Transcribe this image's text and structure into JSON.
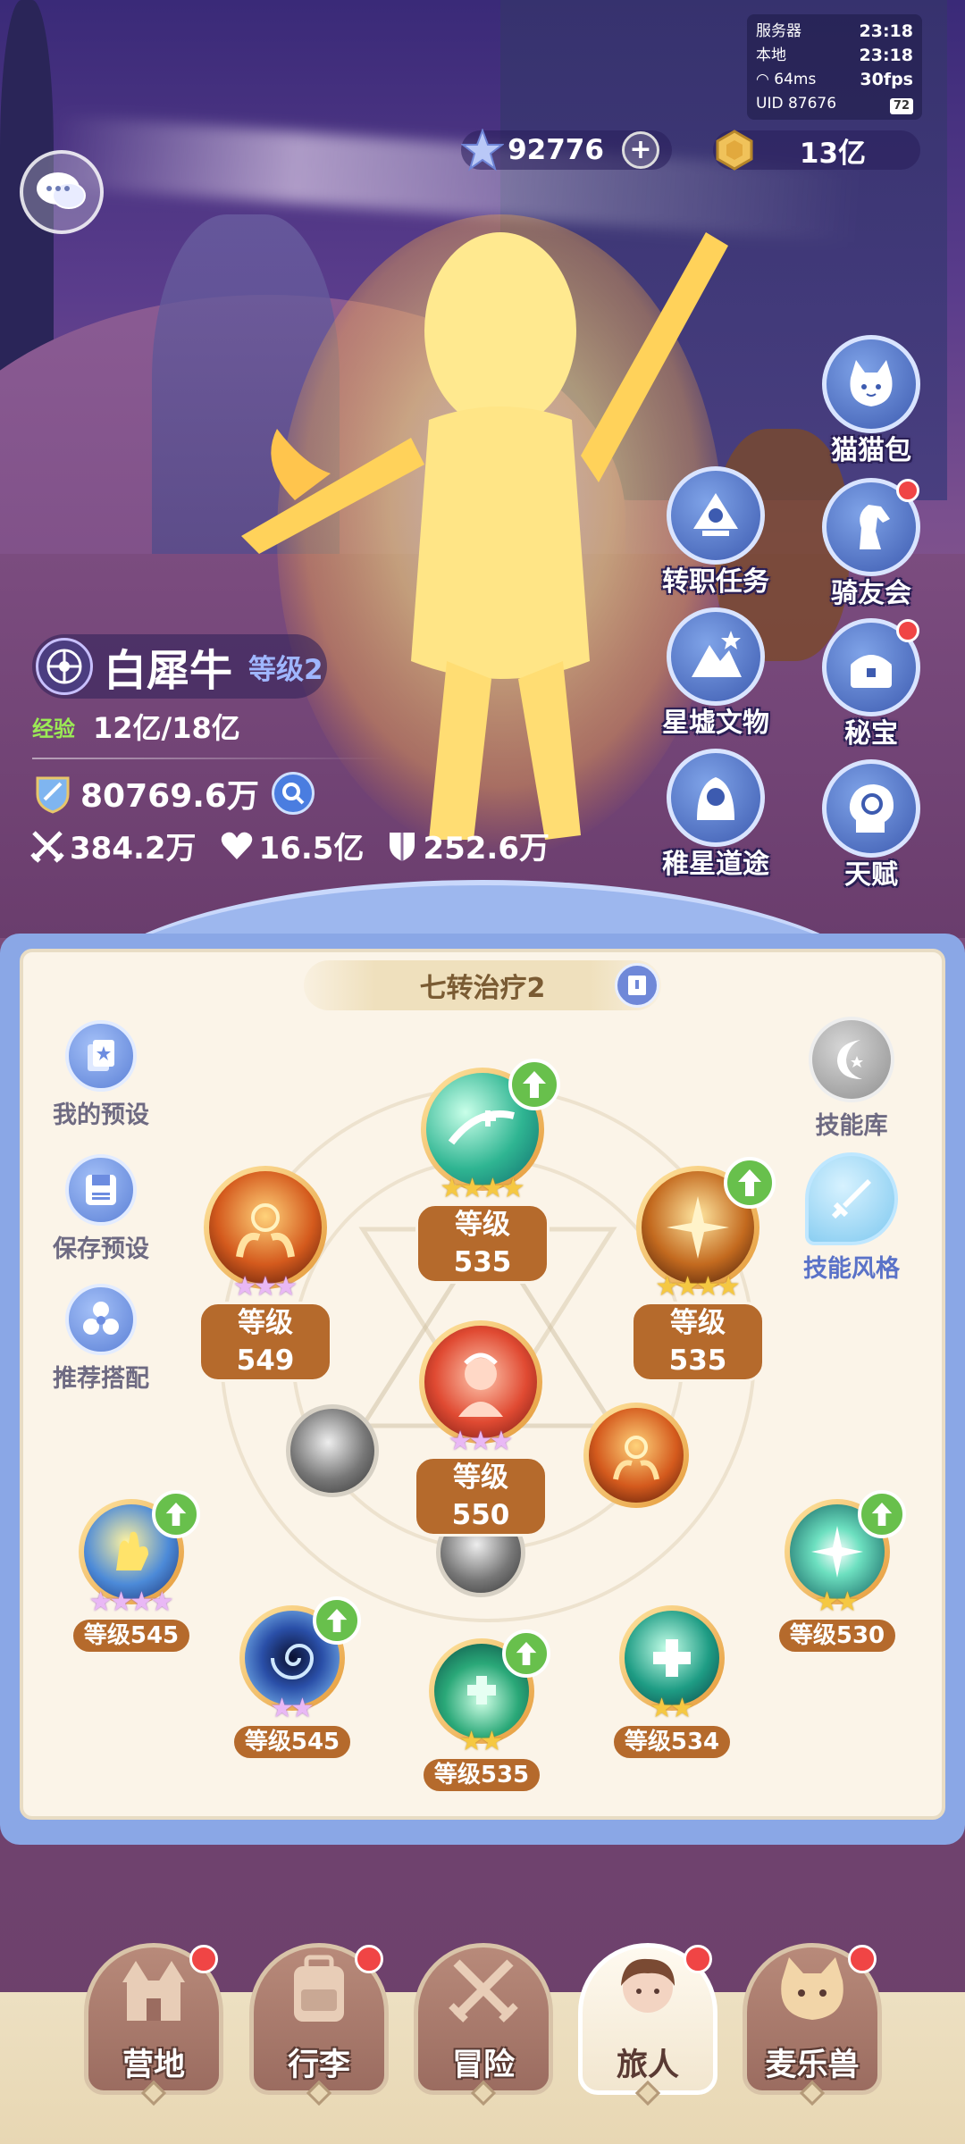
{
  "status": {
    "server_label": "服务器",
    "server_time": "23:18",
    "local_label": "本地",
    "local_time": "23:18",
    "ping": "64ms",
    "fps": "30fps",
    "uid": "UID 87676",
    "battery": "72"
  },
  "currency": {
    "stars": "92776",
    "gold": "13亿"
  },
  "right_menu": [
    {
      "label": "猫猫包",
      "icon": "cat-bag-icon",
      "dot": false
    },
    {
      "label": "转职任务",
      "icon": "job-change-icon",
      "dot": false
    },
    {
      "label": "骑友会",
      "icon": "horse-icon",
      "dot": true
    },
    {
      "label": "星墟文物",
      "icon": "relic-icon",
      "dot": false
    },
    {
      "label": "秘宝",
      "icon": "treasure-icon",
      "dot": true
    },
    {
      "label": "稚星道途",
      "icon": "path-icon",
      "dot": false
    },
    {
      "label": "天赋",
      "icon": "talent-icon",
      "dot": false
    }
  ],
  "character": {
    "name": "白犀牛",
    "level": "等级2",
    "exp_label": "经验",
    "exp": "12亿/18亿",
    "power": "80769.6万",
    "attack": "384.2万",
    "hp": "16.5亿",
    "defense": "252.6万"
  },
  "panel": {
    "preset_title": "七转治疗2",
    "side_left": [
      "我的预设",
      "保存预设",
      "推荐搭配"
    ],
    "side_right": [
      "技能库",
      "技能风格"
    ]
  },
  "skills": [
    {
      "level": "等级535",
      "stars": 4,
      "star_color": "gold",
      "upgrade": true
    },
    {
      "level": "等级549",
      "stars": 3,
      "star_color": "pink",
      "upgrade": false
    },
    {
      "level": "等级535",
      "stars": 4,
      "star_color": "gold",
      "upgrade": true
    },
    {
      "level": "等级550",
      "stars": 3,
      "star_color": "pink",
      "upgrade": false
    },
    {
      "level": "等级545",
      "stars": 4,
      "star_color": "pink",
      "upgrade": true
    },
    {
      "level": "等级545",
      "stars": 2,
      "star_color": "pink",
      "upgrade": true
    },
    {
      "level": "等级535",
      "stars": 2,
      "star_color": "gold",
      "upgrade": true
    },
    {
      "level": "等级534",
      "stars": 2,
      "star_color": "gold",
      "upgrade": false
    },
    {
      "level": "等级530",
      "stars": 2,
      "star_color": "gold",
      "upgrade": true
    }
  ],
  "bottom_nav": [
    {
      "label": "营地",
      "dot": true,
      "active": false
    },
    {
      "label": "行李",
      "dot": true,
      "active": false
    },
    {
      "label": "冒险",
      "dot": false,
      "active": false
    },
    {
      "label": "旅人",
      "dot": true,
      "active": true
    },
    {
      "label": "麦乐兽",
      "dot": true,
      "active": false
    }
  ]
}
